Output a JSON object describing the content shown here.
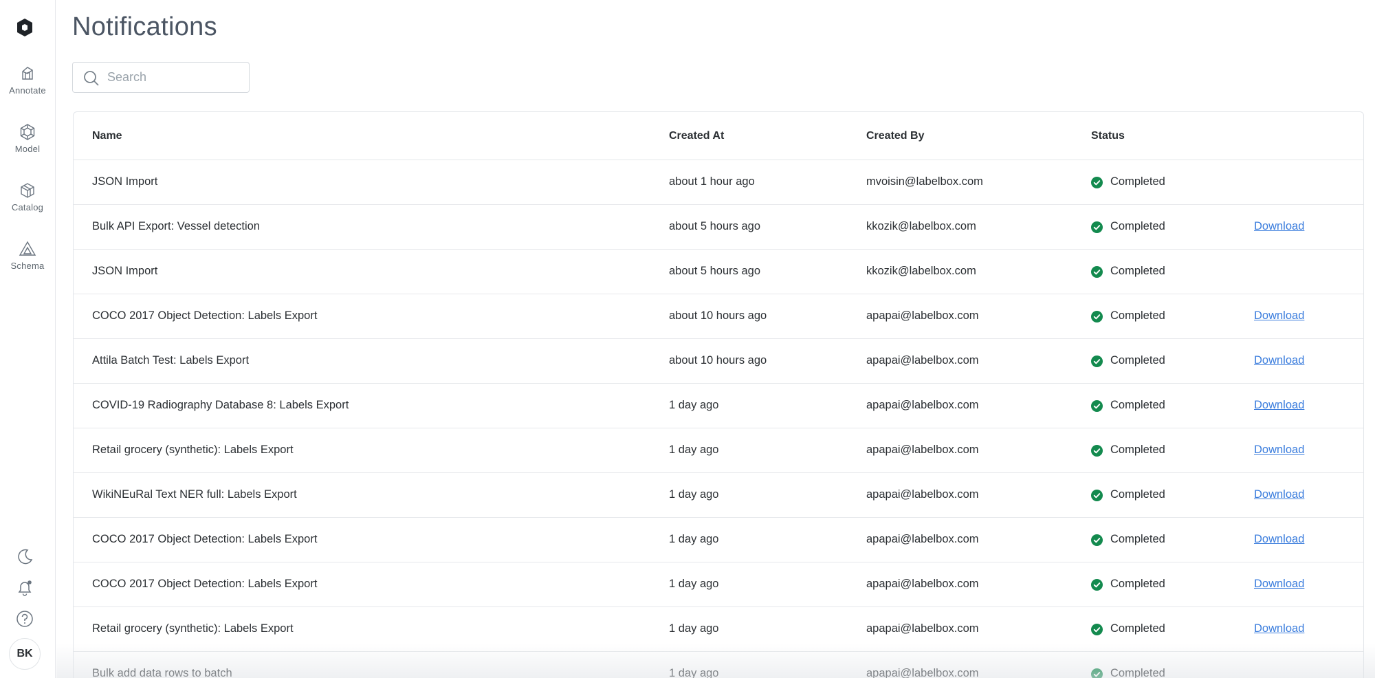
{
  "sidebar": {
    "items": [
      {
        "label": "Annotate",
        "icon": "annotate-icon"
      },
      {
        "label": "Model",
        "icon": "model-icon"
      },
      {
        "label": "Catalog",
        "icon": "catalog-icon"
      },
      {
        "label": "Schema",
        "icon": "schema-icon"
      }
    ],
    "bottom_icons": [
      "moon-icon",
      "bell-icon",
      "help-icon"
    ],
    "avatar_initials": "BK"
  },
  "page": {
    "title": "Notifications",
    "search_placeholder": "Search"
  },
  "table": {
    "columns": [
      "Name",
      "Created At",
      "Created By",
      "Status"
    ],
    "download_label": "Download",
    "rows": [
      {
        "name": "JSON Import",
        "created_at": "about 1 hour ago",
        "created_by": "mvoisin@labelbox.com",
        "status": "Completed",
        "has_download": false
      },
      {
        "name": "Bulk API Export: Vessel detection",
        "created_at": "about 5 hours ago",
        "created_by": "kkozik@labelbox.com",
        "status": "Completed",
        "has_download": true
      },
      {
        "name": "JSON Import",
        "created_at": "about 5 hours ago",
        "created_by": "kkozik@labelbox.com",
        "status": "Completed",
        "has_download": false
      },
      {
        "name": "COCO 2017 Object Detection: Labels Export",
        "created_at": "about 10 hours ago",
        "created_by": "apapai@labelbox.com",
        "status": "Completed",
        "has_download": true
      },
      {
        "name": "Attila Batch Test: Labels Export",
        "created_at": "about 10 hours ago",
        "created_by": "apapai@labelbox.com",
        "status": "Completed",
        "has_download": true
      },
      {
        "name": "COVID-19 Radiography Database 8: Labels Export",
        "created_at": "1 day ago",
        "created_by": "apapai@labelbox.com",
        "status": "Completed",
        "has_download": true
      },
      {
        "name": "Retail grocery (synthetic): Labels Export",
        "created_at": "1 day ago",
        "created_by": "apapai@labelbox.com",
        "status": "Completed",
        "has_download": true
      },
      {
        "name": "WikiNEuRal Text NER full: Labels Export",
        "created_at": "1 day ago",
        "created_by": "apapai@labelbox.com",
        "status": "Completed",
        "has_download": true
      },
      {
        "name": "COCO 2017 Object Detection: Labels Export",
        "created_at": "1 day ago",
        "created_by": "apapai@labelbox.com",
        "status": "Completed",
        "has_download": true
      },
      {
        "name": "COCO 2017 Object Detection: Labels Export",
        "created_at": "1 day ago",
        "created_by": "apapai@labelbox.com",
        "status": "Completed",
        "has_download": true
      },
      {
        "name": "Retail grocery (synthetic): Labels Export",
        "created_at": "1 day ago",
        "created_by": "apapai@labelbox.com",
        "status": "Completed",
        "has_download": true
      },
      {
        "name": "Bulk add data rows to batch",
        "created_at": "1 day ago",
        "created_by": "apapai@labelbox.com",
        "status": "Completed",
        "has_download": false
      }
    ]
  },
  "colors": {
    "status_completed": "#138a4e",
    "link": "#3b7ddd"
  }
}
